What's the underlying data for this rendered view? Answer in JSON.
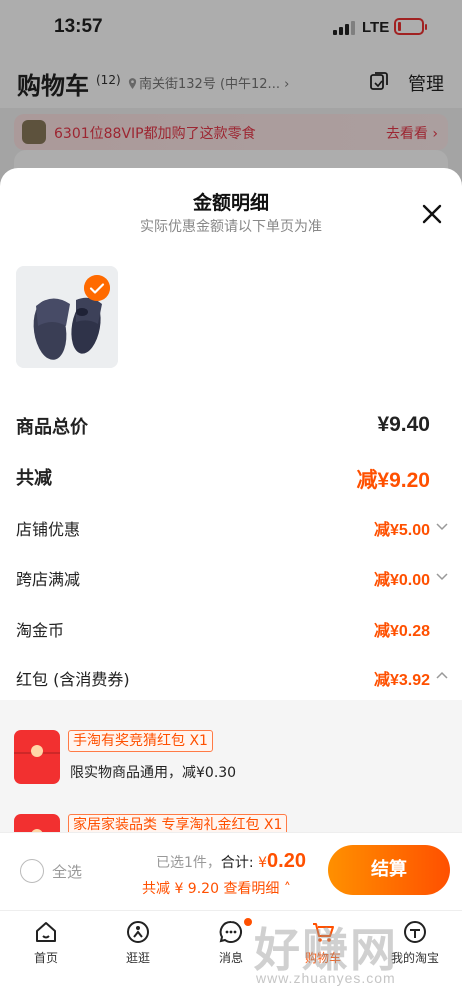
{
  "status": {
    "time": "13:57",
    "network": "LTE"
  },
  "header": {
    "title": "购物车",
    "count": "(12)",
    "address": "南关街132号 (中午12...",
    "manage_label": "管理"
  },
  "vip_banner": {
    "text": "6301位88VIP都加购了这款零食",
    "link": "去看看"
  },
  "sheet": {
    "title": "金额明细",
    "subtitle": "实际优惠金额请以下单页为准",
    "rows": [
      {
        "label": "商品总价",
        "value": "¥9.40"
      },
      {
        "label": "共减",
        "value": "减¥9.20"
      },
      {
        "label": "店铺优惠",
        "value": "减¥5.00"
      },
      {
        "label": "跨店满减",
        "value": "减¥0.00"
      },
      {
        "label": "淘金币",
        "value": "减¥0.28"
      },
      {
        "label": "红包 (含消费券)",
        "value": "减¥3.92"
      }
    ],
    "coupons": [
      {
        "tag": "手淘有奖竞猜红包 X1",
        "desc": "限实物商品通用，减¥0.30"
      },
      {
        "tag": "家居家装品类 专享淘礼金红包 X1",
        "desc": ""
      }
    ]
  },
  "checkout": {
    "select_all": "全选",
    "selected_count": "已选1件，",
    "total_label": "合计:",
    "currency": "¥",
    "total_value": "0.20",
    "discount": "共减 ¥ 9.20",
    "detail_link": "查看明细",
    "button": "结算"
  },
  "tabs": [
    {
      "label": "首页",
      "icon": "home-icon"
    },
    {
      "label": "逛逛",
      "icon": "explore-icon"
    },
    {
      "label": "消息",
      "icon": "message-icon"
    },
    {
      "label": "购物车",
      "icon": "cart-icon"
    },
    {
      "label": "我的淘宝",
      "icon": "profile-icon"
    }
  ],
  "watermark": {
    "big": "好赚网",
    "small": "www.zhuanyes.com"
  },
  "colors": {
    "accent": "#ff5000",
    "banner_text": "#e6394a",
    "coupon_red": "#f23030"
  }
}
